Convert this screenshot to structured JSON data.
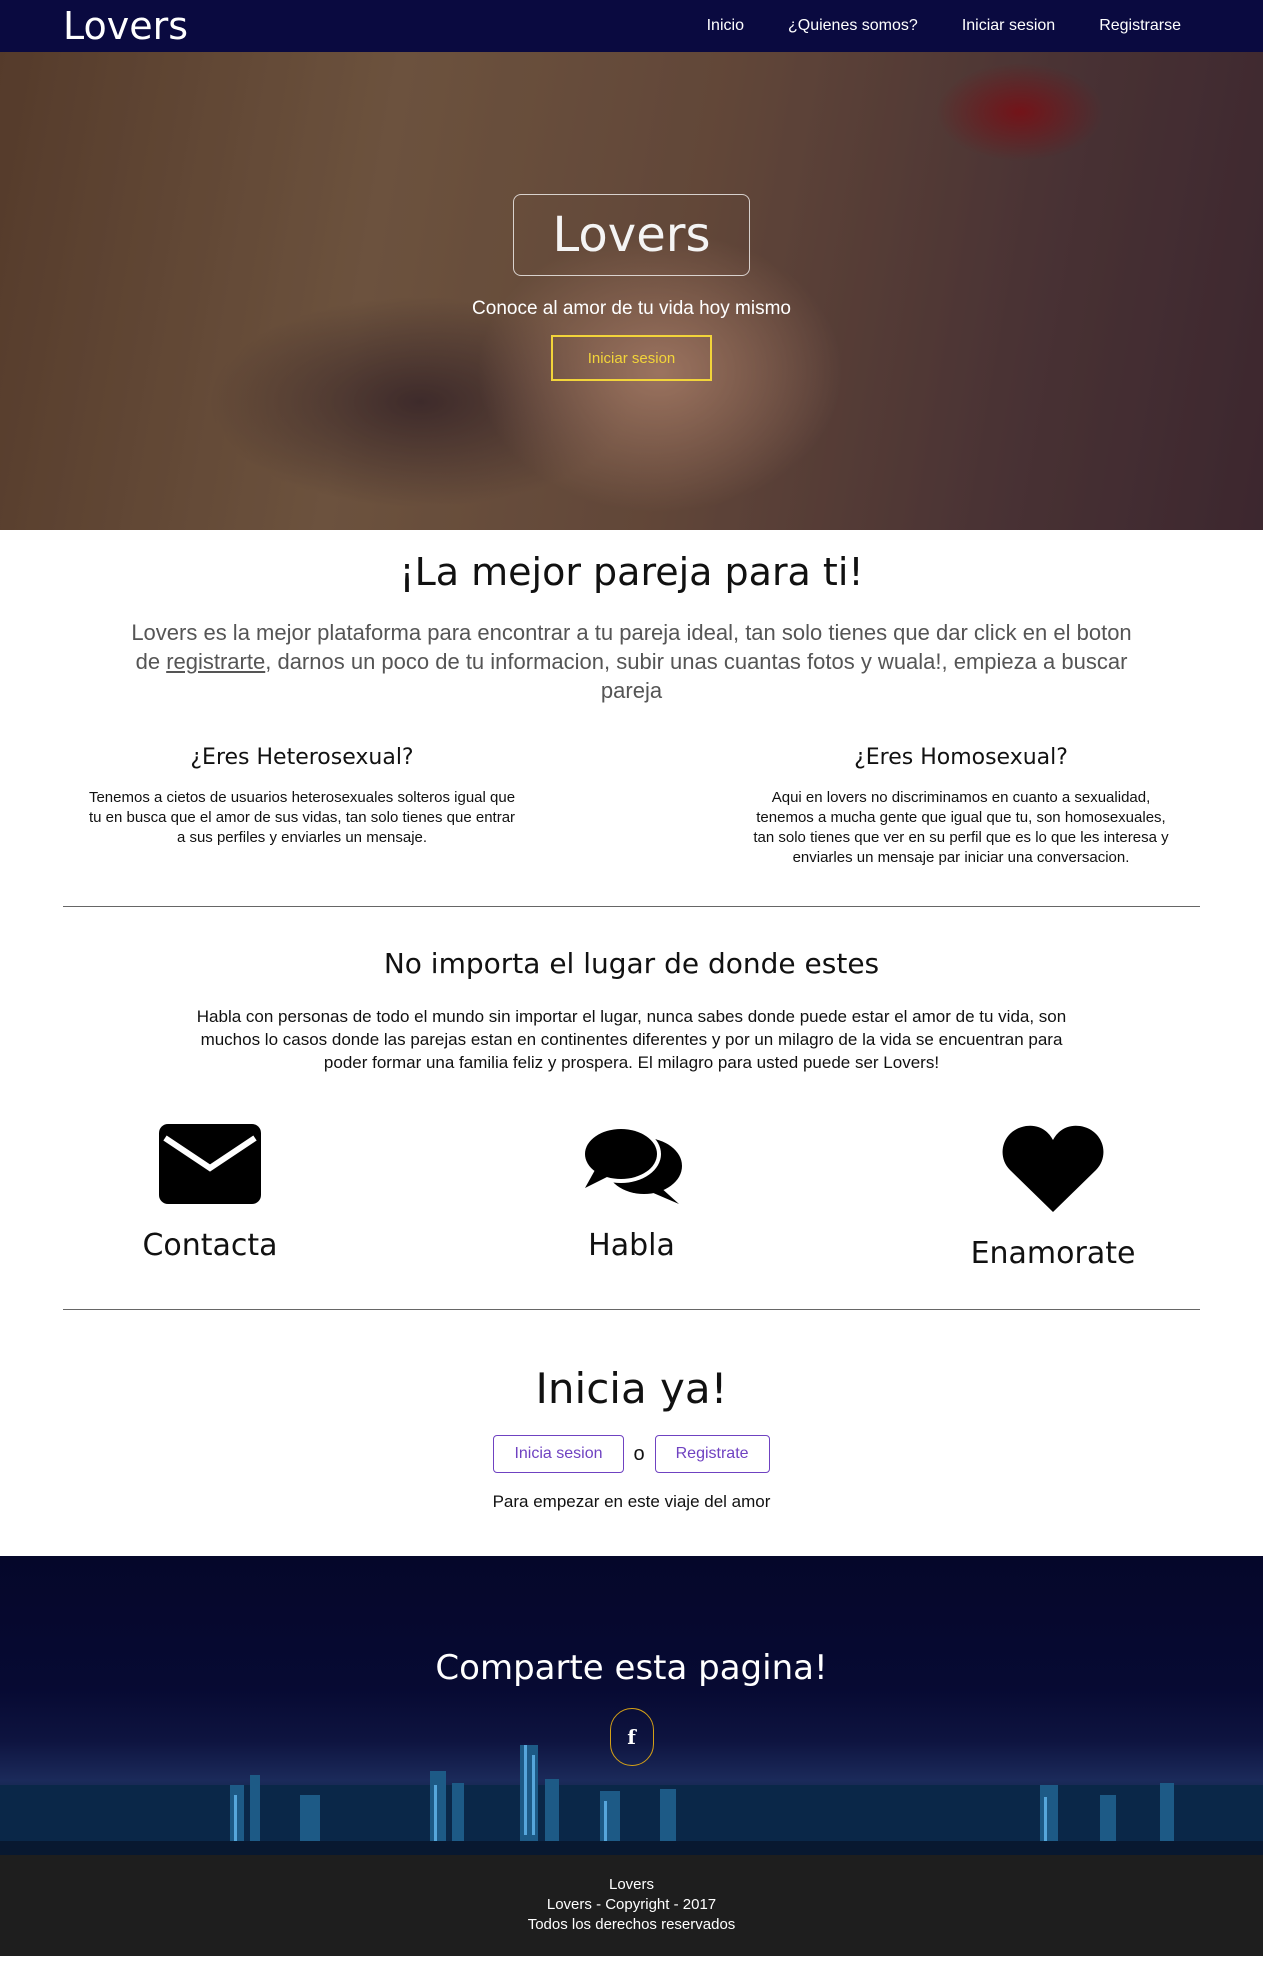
{
  "nav": {
    "brand": "Lovers",
    "links": [
      "Inicio",
      "¿Quienes somos?",
      "Iniciar sesion",
      "Registrarse"
    ]
  },
  "hero": {
    "title": "Lovers",
    "subtitle": "Conoce al amor de tu vida hoy mismo",
    "button": "Iniciar sesion"
  },
  "intro": {
    "heading": "¡La mejor pareja para ti!",
    "text_before": "Lovers es la mejor plataforma para encontrar a tu pareja ideal, tan solo tienes que dar click en el boton de ",
    "link": "registrarte",
    "text_after": ", darnos un poco de tu informacion, subir unas cuantas fotos y wuala!, empieza a buscar pareja"
  },
  "columns": [
    {
      "title": "¿Eres Heterosexual?",
      "text": "Tenemos a cietos de usuarios heterosexuales solteros igual que tu en busca que el amor de sus vidas, tan solo tienes que entrar a sus perfiles y enviarles un mensaje."
    },
    {
      "title": "¿Eres Homosexual?",
      "text": "Aqui en lovers no discriminamos en cuanto a sexualidad, tenemos a mucha gente que igual que tu, son homosexuales, tan solo tienes que ver en su perfil que es lo que les interesa y enviarles un mensaje par iniciar una conversacion."
    }
  ],
  "places": {
    "heading": "No importa el lugar de donde estes",
    "text": "Habla con personas de todo el mundo sin importar el lugar, nunca sabes donde puede estar el amor de tu vida, son muchos lo casos donde las parejas estan en continentes diferentes y por un milagro de la vida se encuentran para poder formar una familia feliz y prospera. El milagro para usted puede ser Lovers!"
  },
  "features": [
    {
      "icon": "envelope-icon",
      "label": "Contacta"
    },
    {
      "icon": "comments-icon",
      "label": "Habla"
    },
    {
      "icon": "heart-icon",
      "label": "Enamorate"
    }
  ],
  "start": {
    "heading": "Inicia ya!",
    "login_button": "Inicia sesion",
    "or": "o",
    "register_button": "Registrate",
    "tagline": "Para empezar en este viaje del amor"
  },
  "share": {
    "heading": "Comparte esta pagina!",
    "facebook_label": "f",
    "facebook_icon": "facebook-icon"
  },
  "footer": {
    "line1": "Lovers",
    "line2": "Lovers - Copyright - 2017",
    "line3": "Todos los derechos reservados"
  }
}
